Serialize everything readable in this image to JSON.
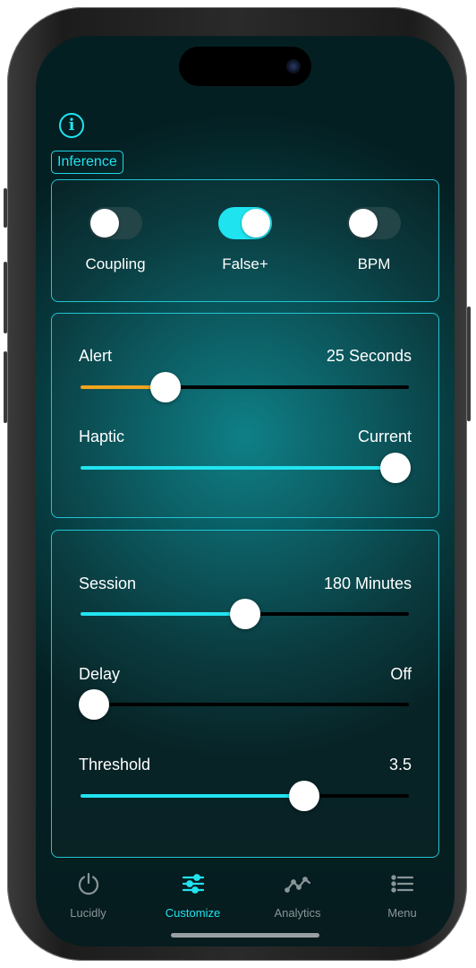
{
  "inference_badge": "Inference",
  "toggles": [
    {
      "label": "Coupling",
      "on": false
    },
    {
      "label": "False+",
      "on": true
    },
    {
      "label": "BPM",
      "on": false
    }
  ],
  "sliders": {
    "alert": {
      "label": "Alert",
      "value_text": "25 Seconds",
      "fraction": 0.26,
      "color": "#f0a51e"
    },
    "haptic": {
      "label": "Haptic",
      "value_text": "Current",
      "fraction": 0.96,
      "color": "#22e3f0"
    },
    "session": {
      "label": "Session",
      "value_text": "180 Minutes",
      "fraction": 0.5,
      "color": "#22e3f0"
    },
    "delay": {
      "label": "Delay",
      "value_text": "Off",
      "fraction": 0.04,
      "color": "#22e3f0"
    },
    "threshold": {
      "label": "Threshold",
      "value_text": "3.5",
      "fraction": 0.68,
      "color": "#22e3f0"
    }
  },
  "tabs": [
    {
      "label": "Lucidly",
      "icon": "power-icon",
      "active": false
    },
    {
      "label": "Customize",
      "icon": "sliders-icon",
      "active": true
    },
    {
      "label": "Analytics",
      "icon": "chart-line-icon",
      "active": false
    },
    {
      "label": "Menu",
      "icon": "list-icon",
      "active": false
    }
  ],
  "colors": {
    "accent": "#22e3f0",
    "alert_fill": "#f0a51e"
  }
}
